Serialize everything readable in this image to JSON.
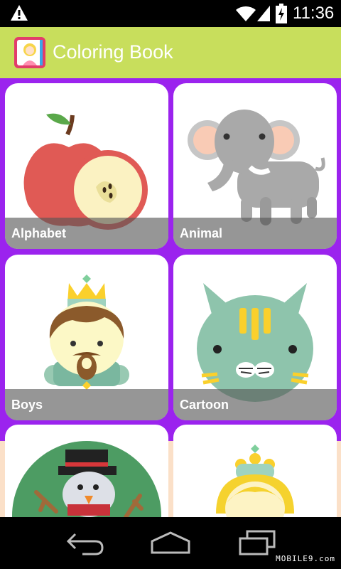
{
  "status_bar": {
    "time": "11:36",
    "icons": [
      "warning-icon",
      "wifi-signal-icon",
      "cell-signal-icon",
      "battery-charging-icon"
    ]
  },
  "action_bar": {
    "app_icon": "coloring-book-app-icon",
    "title": "Coloring Book",
    "color": "#c8de5c"
  },
  "grid": {
    "background": "#9b23ee",
    "categories": [
      {
        "label": "Alphabet",
        "art": "apple-icon"
      },
      {
        "label": "Animal",
        "art": "elephant-icon"
      },
      {
        "label": "Boys",
        "art": "prince-icon"
      },
      {
        "label": "Cartoon",
        "art": "cat-icon"
      },
      {
        "label": "",
        "art": "snowman-icon"
      },
      {
        "label": "",
        "art": "princess-icon"
      }
    ]
  },
  "nav_bar": {
    "buttons": [
      "back-icon",
      "home-icon",
      "recent-apps-icon"
    ]
  },
  "watermark": "MOBILE9.com"
}
